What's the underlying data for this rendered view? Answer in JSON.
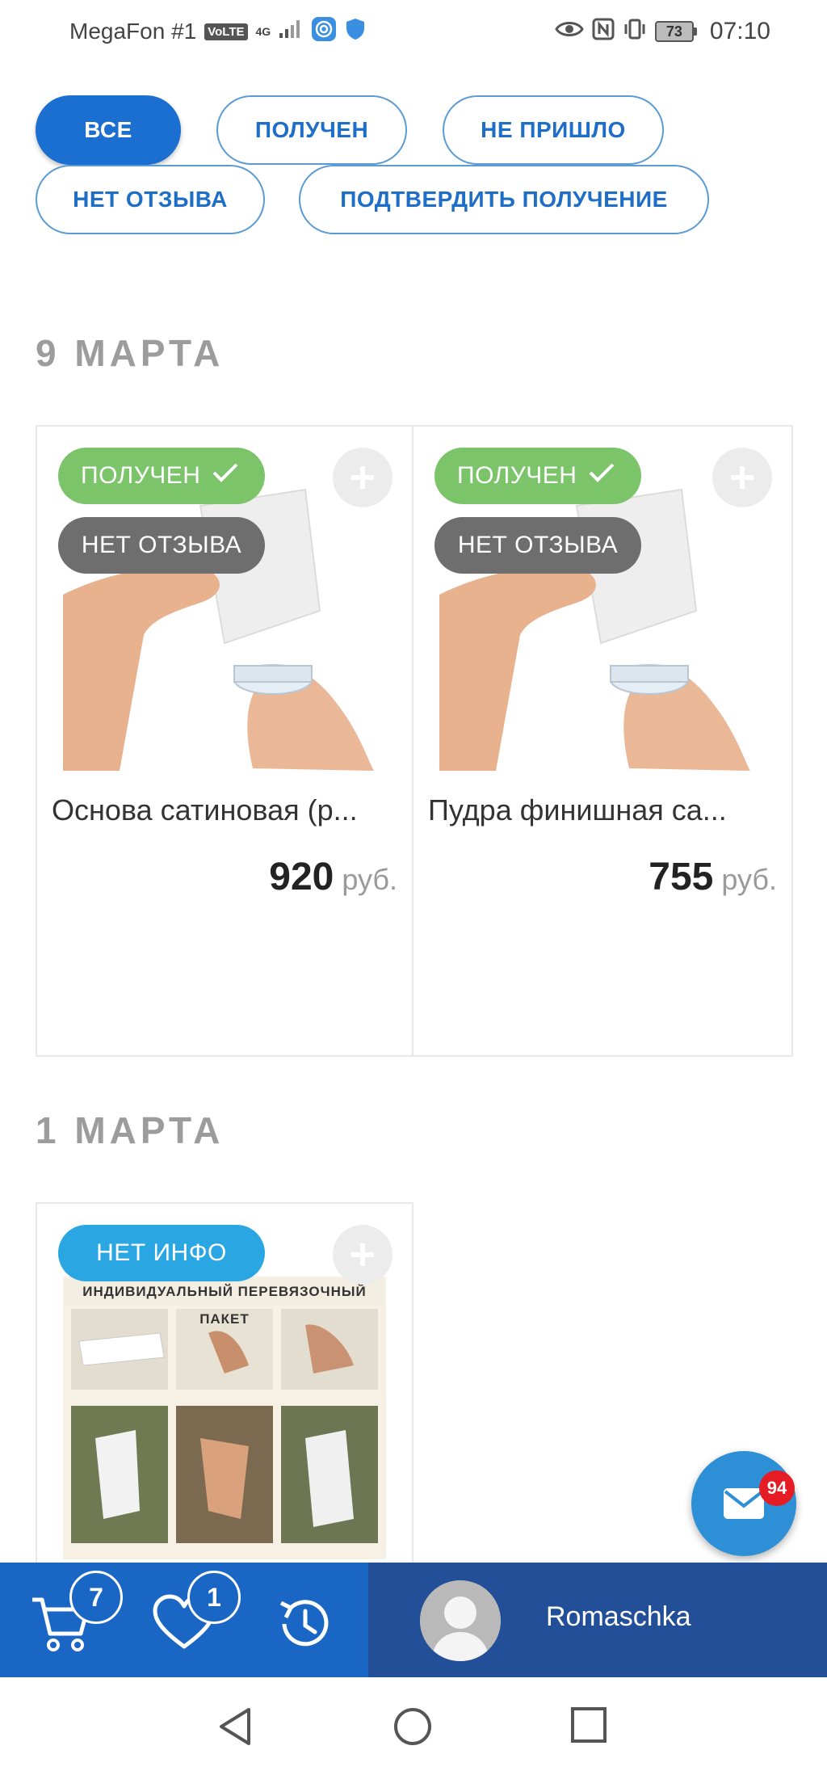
{
  "status_bar": {
    "carrier": "MegaFon #1",
    "volte": "VoLTE",
    "network": "4G",
    "battery": "73",
    "time": "07:10"
  },
  "filters": [
    {
      "label": "ВСЕ",
      "active": true
    },
    {
      "label": "ПОЛУЧЕН",
      "active": false
    },
    {
      "label": "НЕ ПРИШЛО",
      "active": false
    },
    {
      "label": "НЕТ ОТЗЫВА",
      "active": false
    },
    {
      "label": "ПОДТВЕРДИТЬ ПОЛУЧЕНИЕ",
      "active": false
    }
  ],
  "groups": [
    {
      "date": "9 МАРТА",
      "items": [
        {
          "badges": [
            "ПОЛУЧЕН",
            "НЕТ ОТЗЫВА"
          ],
          "title": "Основа сатиновая (р...",
          "price": "920",
          "currency": "руб."
        },
        {
          "badges": [
            "ПОЛУЧЕН",
            "НЕТ ОТЗЫВА"
          ],
          "title": "Пудра финишная са...",
          "price": "755",
          "currency": "руб."
        }
      ]
    },
    {
      "date": "1 МАРТА",
      "items": [
        {
          "badges": [
            "НЕТ ИНФО"
          ],
          "image_caption": "ИНДИВИДУАЛЬНЫЙ ПЕРЕВЯЗОЧНЫЙ ПАКЕТ"
        }
      ]
    }
  ],
  "fab": {
    "unread_count": "94"
  },
  "bottom_bar": {
    "cart_count": "7",
    "favorites_count": "1",
    "username": "Romaschka"
  },
  "colors": {
    "primary": "#1b6fd0",
    "received_badge": "#7bc46a",
    "no_review_badge": "#6e6e6e",
    "no_info_badge": "#2aa7e2",
    "bottom_left": "#1a66c4",
    "bottom_right": "#234f99",
    "notification": "#e51c23"
  }
}
